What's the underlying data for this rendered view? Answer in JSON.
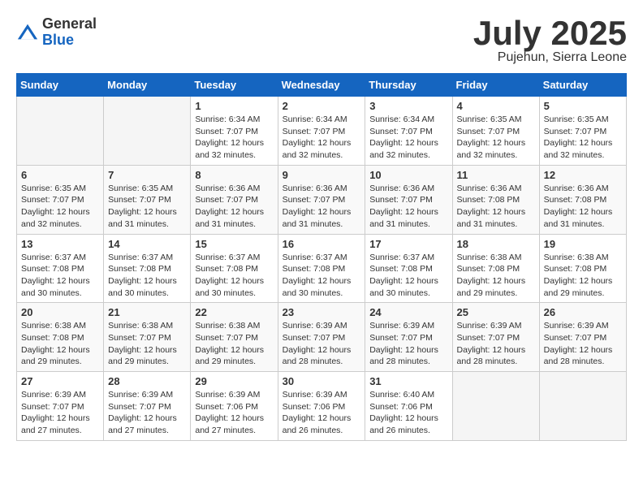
{
  "logo": {
    "general": "General",
    "blue": "Blue"
  },
  "header": {
    "month": "July 2025",
    "location": "Pujehun, Sierra Leone"
  },
  "days_of_week": [
    "Sunday",
    "Monday",
    "Tuesday",
    "Wednesday",
    "Thursday",
    "Friday",
    "Saturday"
  ],
  "weeks": [
    [
      {
        "day": "",
        "sunrise": "",
        "sunset": "",
        "daylight": ""
      },
      {
        "day": "",
        "sunrise": "",
        "sunset": "",
        "daylight": ""
      },
      {
        "day": "1",
        "sunrise": "Sunrise: 6:34 AM",
        "sunset": "Sunset: 7:07 PM",
        "daylight": "Daylight: 12 hours and 32 minutes."
      },
      {
        "day": "2",
        "sunrise": "Sunrise: 6:34 AM",
        "sunset": "Sunset: 7:07 PM",
        "daylight": "Daylight: 12 hours and 32 minutes."
      },
      {
        "day": "3",
        "sunrise": "Sunrise: 6:34 AM",
        "sunset": "Sunset: 7:07 PM",
        "daylight": "Daylight: 12 hours and 32 minutes."
      },
      {
        "day": "4",
        "sunrise": "Sunrise: 6:35 AM",
        "sunset": "Sunset: 7:07 PM",
        "daylight": "Daylight: 12 hours and 32 minutes."
      },
      {
        "day": "5",
        "sunrise": "Sunrise: 6:35 AM",
        "sunset": "Sunset: 7:07 PM",
        "daylight": "Daylight: 12 hours and 32 minutes."
      }
    ],
    [
      {
        "day": "6",
        "sunrise": "Sunrise: 6:35 AM",
        "sunset": "Sunset: 7:07 PM",
        "daylight": "Daylight: 12 hours and 32 minutes."
      },
      {
        "day": "7",
        "sunrise": "Sunrise: 6:35 AM",
        "sunset": "Sunset: 7:07 PM",
        "daylight": "Daylight: 12 hours and 31 minutes."
      },
      {
        "day": "8",
        "sunrise": "Sunrise: 6:36 AM",
        "sunset": "Sunset: 7:07 PM",
        "daylight": "Daylight: 12 hours and 31 minutes."
      },
      {
        "day": "9",
        "sunrise": "Sunrise: 6:36 AM",
        "sunset": "Sunset: 7:07 PM",
        "daylight": "Daylight: 12 hours and 31 minutes."
      },
      {
        "day": "10",
        "sunrise": "Sunrise: 6:36 AM",
        "sunset": "Sunset: 7:07 PM",
        "daylight": "Daylight: 12 hours and 31 minutes."
      },
      {
        "day": "11",
        "sunrise": "Sunrise: 6:36 AM",
        "sunset": "Sunset: 7:08 PM",
        "daylight": "Daylight: 12 hours and 31 minutes."
      },
      {
        "day": "12",
        "sunrise": "Sunrise: 6:36 AM",
        "sunset": "Sunset: 7:08 PM",
        "daylight": "Daylight: 12 hours and 31 minutes."
      }
    ],
    [
      {
        "day": "13",
        "sunrise": "Sunrise: 6:37 AM",
        "sunset": "Sunset: 7:08 PM",
        "daylight": "Daylight: 12 hours and 30 minutes."
      },
      {
        "day": "14",
        "sunrise": "Sunrise: 6:37 AM",
        "sunset": "Sunset: 7:08 PM",
        "daylight": "Daylight: 12 hours and 30 minutes."
      },
      {
        "day": "15",
        "sunrise": "Sunrise: 6:37 AM",
        "sunset": "Sunset: 7:08 PM",
        "daylight": "Daylight: 12 hours and 30 minutes."
      },
      {
        "day": "16",
        "sunrise": "Sunrise: 6:37 AM",
        "sunset": "Sunset: 7:08 PM",
        "daylight": "Daylight: 12 hours and 30 minutes."
      },
      {
        "day": "17",
        "sunrise": "Sunrise: 6:37 AM",
        "sunset": "Sunset: 7:08 PM",
        "daylight": "Daylight: 12 hours and 30 minutes."
      },
      {
        "day": "18",
        "sunrise": "Sunrise: 6:38 AM",
        "sunset": "Sunset: 7:08 PM",
        "daylight": "Daylight: 12 hours and 29 minutes."
      },
      {
        "day": "19",
        "sunrise": "Sunrise: 6:38 AM",
        "sunset": "Sunset: 7:08 PM",
        "daylight": "Daylight: 12 hours and 29 minutes."
      }
    ],
    [
      {
        "day": "20",
        "sunrise": "Sunrise: 6:38 AM",
        "sunset": "Sunset: 7:08 PM",
        "daylight": "Daylight: 12 hours and 29 minutes."
      },
      {
        "day": "21",
        "sunrise": "Sunrise: 6:38 AM",
        "sunset": "Sunset: 7:07 PM",
        "daylight": "Daylight: 12 hours and 29 minutes."
      },
      {
        "day": "22",
        "sunrise": "Sunrise: 6:38 AM",
        "sunset": "Sunset: 7:07 PM",
        "daylight": "Daylight: 12 hours and 29 minutes."
      },
      {
        "day": "23",
        "sunrise": "Sunrise: 6:39 AM",
        "sunset": "Sunset: 7:07 PM",
        "daylight": "Daylight: 12 hours and 28 minutes."
      },
      {
        "day": "24",
        "sunrise": "Sunrise: 6:39 AM",
        "sunset": "Sunset: 7:07 PM",
        "daylight": "Daylight: 12 hours and 28 minutes."
      },
      {
        "day": "25",
        "sunrise": "Sunrise: 6:39 AM",
        "sunset": "Sunset: 7:07 PM",
        "daylight": "Daylight: 12 hours and 28 minutes."
      },
      {
        "day": "26",
        "sunrise": "Sunrise: 6:39 AM",
        "sunset": "Sunset: 7:07 PM",
        "daylight": "Daylight: 12 hours and 28 minutes."
      }
    ],
    [
      {
        "day": "27",
        "sunrise": "Sunrise: 6:39 AM",
        "sunset": "Sunset: 7:07 PM",
        "daylight": "Daylight: 12 hours and 27 minutes."
      },
      {
        "day": "28",
        "sunrise": "Sunrise: 6:39 AM",
        "sunset": "Sunset: 7:07 PM",
        "daylight": "Daylight: 12 hours and 27 minutes."
      },
      {
        "day": "29",
        "sunrise": "Sunrise: 6:39 AM",
        "sunset": "Sunset: 7:06 PM",
        "daylight": "Daylight: 12 hours and 27 minutes."
      },
      {
        "day": "30",
        "sunrise": "Sunrise: 6:39 AM",
        "sunset": "Sunset: 7:06 PM",
        "daylight": "Daylight: 12 hours and 26 minutes."
      },
      {
        "day": "31",
        "sunrise": "Sunrise: 6:40 AM",
        "sunset": "Sunset: 7:06 PM",
        "daylight": "Daylight: 12 hours and 26 minutes."
      },
      {
        "day": "",
        "sunrise": "",
        "sunset": "",
        "daylight": ""
      },
      {
        "day": "",
        "sunrise": "",
        "sunset": "",
        "daylight": ""
      }
    ]
  ]
}
